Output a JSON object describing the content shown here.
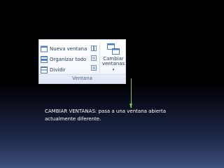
{
  "ribbon": {
    "items": [
      {
        "label": "Nueva ventana",
        "icon": "new-window-icon"
      },
      {
        "label": "Organizar todo",
        "icon": "arrange-all-icon"
      },
      {
        "label": "Dividir",
        "icon": "split-icon"
      }
    ],
    "switch_button": {
      "line1": "Cambiar",
      "line2": "ventanas",
      "icon": "switch-windows-icon"
    },
    "group_label": "Ventana"
  },
  "caption": {
    "line1": "CAMBIAR VENTANAS: pasa a una ventana abierta",
    "line2": "actualmente diferente."
  },
  "colors": {
    "background": "#000000",
    "ribbon_text": "#1e395b",
    "arrow": "#7ec65a",
    "caption_text": "#ffffff"
  }
}
